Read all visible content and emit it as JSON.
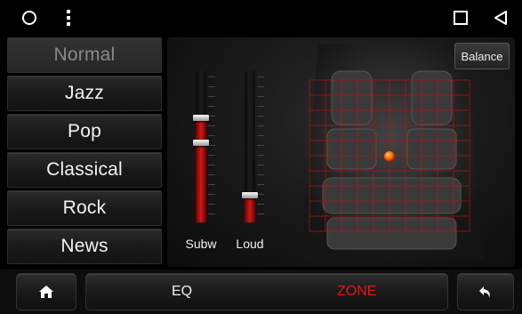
{
  "status_bar": {
    "circle_icon": "circle-icon",
    "menu_icon": "vertical-dots-icon",
    "square_icon": "square-icon",
    "back_icon": "triangle-back-icon"
  },
  "presets": [
    {
      "label": "Normal",
      "selected": true
    },
    {
      "label": "Jazz",
      "selected": false
    },
    {
      "label": "Pop",
      "selected": false
    },
    {
      "label": "Classical",
      "selected": false
    },
    {
      "label": "Rock",
      "selected": false
    },
    {
      "label": "News",
      "selected": false
    }
  ],
  "panel": {
    "balance_label": "Balance",
    "sliders": [
      {
        "label": "Subw",
        "level": 0.78
      },
      {
        "label": "Loud",
        "level": 0.2
      }
    ],
    "accent_color": "#d01818",
    "focus_point_color": "#ff6a00"
  },
  "bottom_bar": {
    "home_icon": "home-icon",
    "tabs": [
      {
        "label": "EQ",
        "active": false,
        "color": "#f0f0f0"
      },
      {
        "label": "ZONE",
        "active": true,
        "color": "#e01818"
      }
    ],
    "back_icon": "back-arrow-icon"
  }
}
